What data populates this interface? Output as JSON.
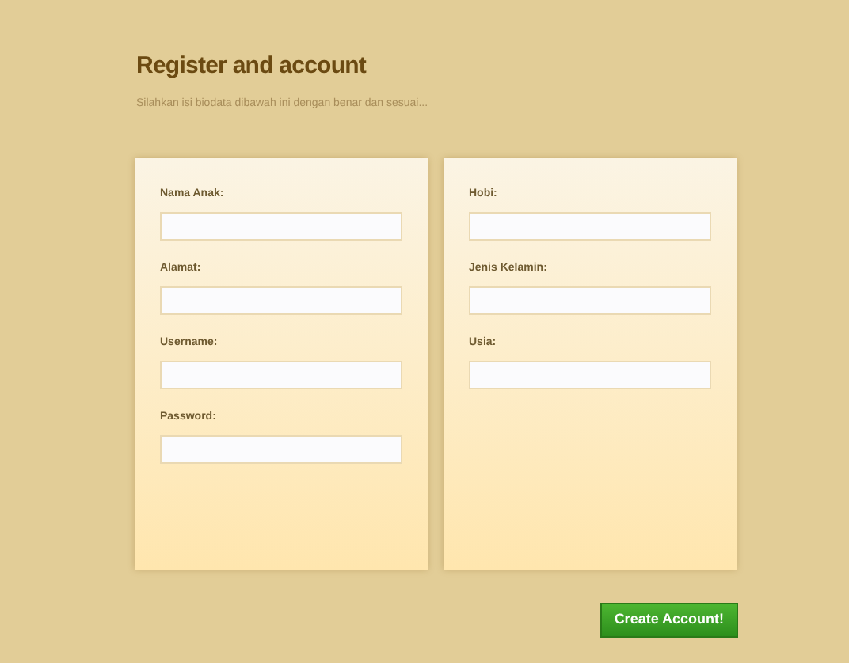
{
  "header": {
    "title": "Register and account",
    "subtitle": "Silahkan isi biodata dibawah ini dengan benar dan sesuai..."
  },
  "panels": [
    {
      "fields": [
        {
          "label": "Nama Anak:"
        },
        {
          "label": "Alamat:"
        },
        {
          "label": "Username:"
        },
        {
          "label": "Password:"
        }
      ]
    },
    {
      "fields": [
        {
          "label": "Hobi:"
        },
        {
          "label": "Jenis Kelamin:"
        },
        {
          "label": "Usia:"
        }
      ]
    }
  ],
  "submit_button": "Create Account!"
}
